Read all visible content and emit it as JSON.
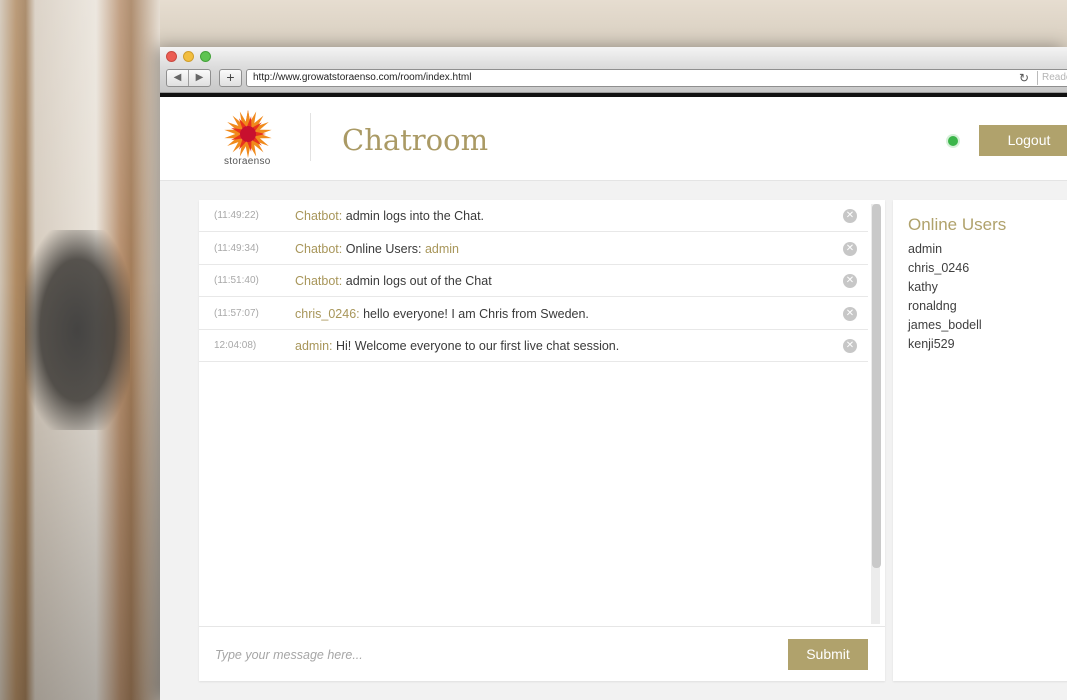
{
  "browser": {
    "url": "http://www.growatstoraenso.com/room/index.html",
    "reader_label": "Reader",
    "back_glyph": "◀",
    "forward_glyph": "▶",
    "new_tab_glyph": "+",
    "reload_glyph": "↻"
  },
  "header": {
    "logo_text": "storaenso",
    "title": "Chatroom",
    "logout_label": "Logout",
    "status_color": "#3bb54a"
  },
  "chat": {
    "messages": [
      {
        "time": "(11:49:22)",
        "sender": "Chatbot:",
        "text": " admin logs into the Chat.",
        "accent": ""
      },
      {
        "time": "(11:49:34)",
        "sender": "Chatbot:",
        "text": " Online Users: ",
        "accent": "admin"
      },
      {
        "time": "(11:51:40)",
        "sender": "Chatbot:",
        "text": " admin logs out of the Chat",
        "accent": ""
      },
      {
        "time": "(11:57:07)",
        "sender": "chris_0246:",
        "text": " hello everyone! I am Chris from Sweden.",
        "accent": ""
      },
      {
        "time": "12:04:08)",
        "sender": "admin:",
        "text": " Hi! Welcome everyone to our first live chat session.",
        "accent": ""
      }
    ],
    "close_glyph": "✕",
    "compose_placeholder": "Type your message here...",
    "submit_label": "Submit"
  },
  "users": {
    "title": "Online Users",
    "list": [
      "admin",
      "chris_0246",
      "kathy",
      "ronaldng",
      "james_bodell",
      "kenji529"
    ]
  },
  "colors": {
    "accent": "#b0a26c",
    "sender": "#a8965a"
  }
}
